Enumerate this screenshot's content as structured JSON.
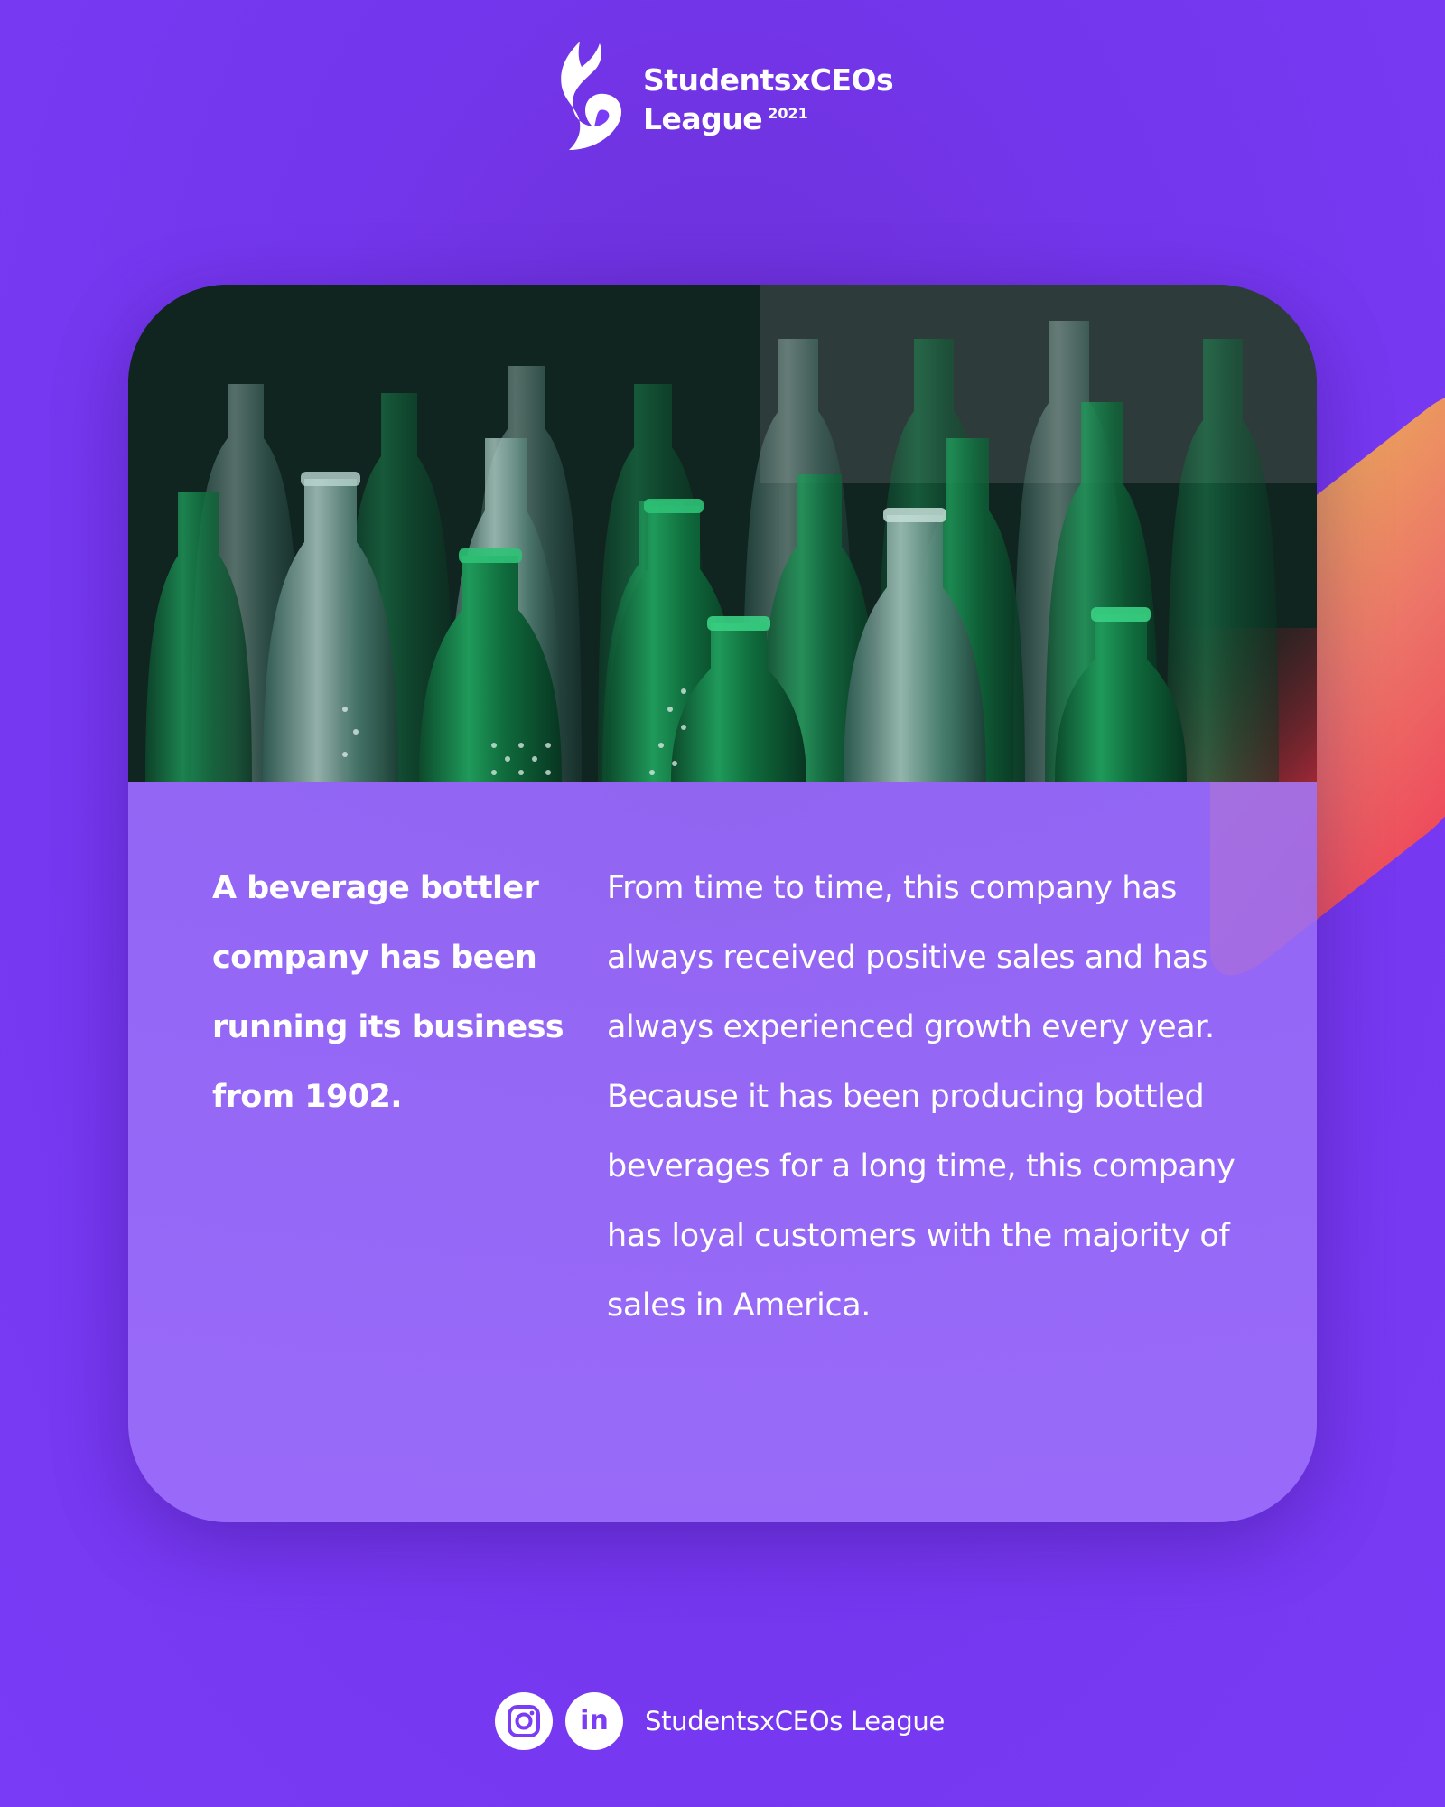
{
  "header": {
    "brand_line1": "StudentsxCEOs",
    "brand_line2": "League",
    "brand_year": "2021"
  },
  "card": {
    "photo_subject": "green-glass-bottles",
    "intro_text": "A beverage bottler company has been running its business from 1902.",
    "body_text": "From time to time, this company has always received positive sales and has always experienced growth every year. Because it has been producing bottled beverages for a long time, this company has loyal customers with the majority of sales in America."
  },
  "footer": {
    "icons": [
      "instagram-icon",
      "linkedin-icon"
    ],
    "linkedin_glyph": "in",
    "handle": "StudentsxCEOs League"
  },
  "colors": {
    "background": "#7a3cf5",
    "card": "#9a6ef8",
    "accent_gradient_start": "#eba55c",
    "accent_gradient_end": "#ee4a5b",
    "text": "#ffffff"
  }
}
